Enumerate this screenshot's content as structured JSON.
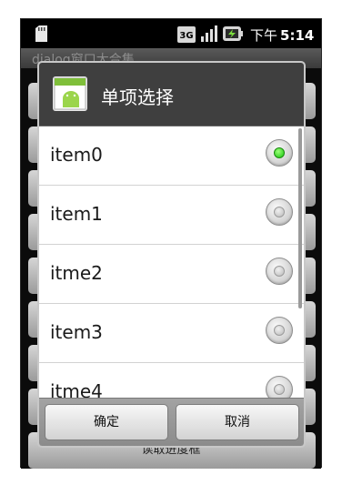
{
  "status_bar": {
    "network": "3G",
    "ampm": "下午",
    "time": "5:14",
    "icons": [
      "sd-card-icon",
      "3g-icon",
      "signal-icon",
      "battery-icon"
    ]
  },
  "app": {
    "title": "dialog窗口大合集",
    "background_bottom_text": "读取进度框"
  },
  "dialog": {
    "title": "单项选择",
    "icon": "android-app-icon",
    "items": [
      {
        "label": "item0",
        "checked": true
      },
      {
        "label": "item1",
        "checked": false
      },
      {
        "label": "itme2",
        "checked": false
      },
      {
        "label": "item3",
        "checked": false
      },
      {
        "label": "itme4",
        "checked": false
      }
    ],
    "ok_label": "确定",
    "cancel_label": "取消"
  },
  "colors": {
    "accent_check": "#14c50a",
    "dialog_header": "#3f3f3f"
  }
}
